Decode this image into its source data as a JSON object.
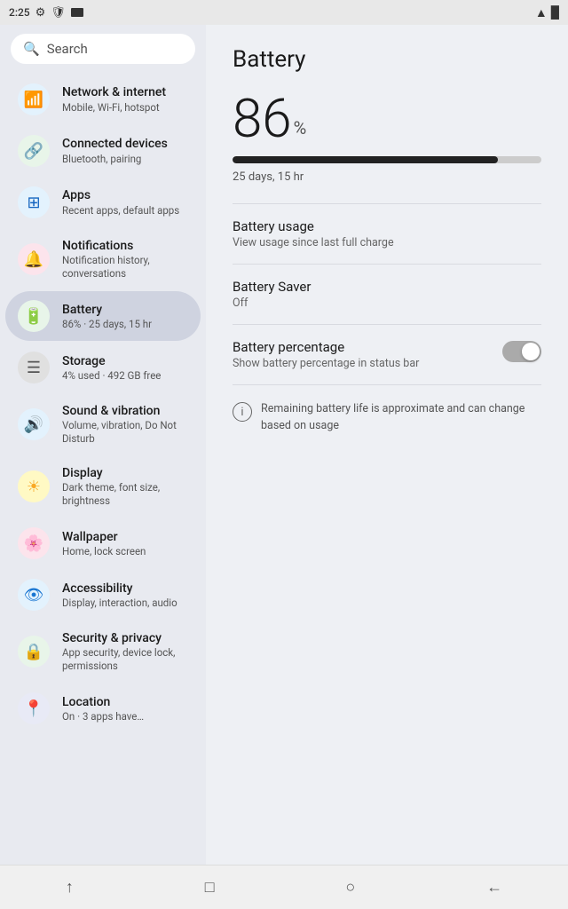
{
  "statusBar": {
    "time": "2:25",
    "wifiIcon": "▲",
    "batteryIcon": "🔋"
  },
  "search": {
    "placeholder": "Search"
  },
  "sidebar": {
    "items": [
      {
        "id": "network",
        "title": "Network &\ninternet",
        "subtitle": "Mobile, Wi-Fi, hotspot",
        "icon": "📶",
        "iconClass": "icon-network",
        "active": false
      },
      {
        "id": "connected",
        "title": "Connected\ndevices",
        "subtitle": "Bluetooth, pairing",
        "icon": "🔗",
        "iconClass": "icon-connected",
        "active": false
      },
      {
        "id": "apps",
        "title": "Apps",
        "subtitle": "Recent apps, default apps",
        "icon": "⊞",
        "iconClass": "icon-apps",
        "active": false
      },
      {
        "id": "notifications",
        "title": "Notifications",
        "subtitle": "Notification history, conversations",
        "icon": "🔔",
        "iconClass": "icon-notif",
        "active": false
      },
      {
        "id": "battery",
        "title": "Battery",
        "subtitle": "86% · 25 days, 15 hr",
        "icon": "🔋",
        "iconClass": "icon-battery",
        "active": true
      },
      {
        "id": "storage",
        "title": "Storage",
        "subtitle": "4% used · 492 GB free",
        "icon": "☰",
        "iconClass": "icon-storage",
        "active": false
      },
      {
        "id": "sound",
        "title": "Sound &\nvibration",
        "subtitle": "Volume, vibration, Do Not Disturb",
        "icon": "🔊",
        "iconClass": "icon-sound",
        "active": false
      },
      {
        "id": "display",
        "title": "Display",
        "subtitle": "Dark theme, font size, brightness",
        "icon": "☀",
        "iconClass": "icon-display",
        "active": false
      },
      {
        "id": "wallpaper",
        "title": "Wallpaper",
        "subtitle": "Home, lock screen",
        "icon": "🌸",
        "iconClass": "icon-wallpaper",
        "active": false
      },
      {
        "id": "accessibility",
        "title": "Accessibility",
        "subtitle": "Display, interaction, audio",
        "icon": "👁",
        "iconClass": "icon-access",
        "active": false
      },
      {
        "id": "security",
        "title": "Security &\nprivacy",
        "subtitle": "App security, device lock, permissions",
        "icon": "🔒",
        "iconClass": "icon-security",
        "active": false
      },
      {
        "id": "location",
        "title": "Location",
        "subtitle": "On · 3 apps have…",
        "icon": "📍",
        "iconClass": "icon-location",
        "active": false
      }
    ]
  },
  "content": {
    "title": "Battery",
    "percent": "86",
    "percentSymbol": "%",
    "progressPercent": 86,
    "timeRemaining": "25 days, 15 hr",
    "rows": [
      {
        "id": "battery-usage",
        "title": "Battery usage",
        "subtitle": "View usage since last full charge",
        "hasToggle": false,
        "hasArrow": false
      },
      {
        "id": "battery-saver",
        "title": "Battery Saver",
        "subtitle": "Off",
        "hasToggle": false,
        "hasArrow": false
      },
      {
        "id": "battery-percentage",
        "title": "Battery percentage",
        "subtitle": "Show battery percentage in status bar",
        "hasToggle": true,
        "toggleOn": false
      }
    ],
    "infoText": "Remaining battery life is approximate and can change based on usage"
  },
  "bottomNav": {
    "back": "←",
    "home": "○",
    "recents": "□",
    "share": "↑"
  }
}
